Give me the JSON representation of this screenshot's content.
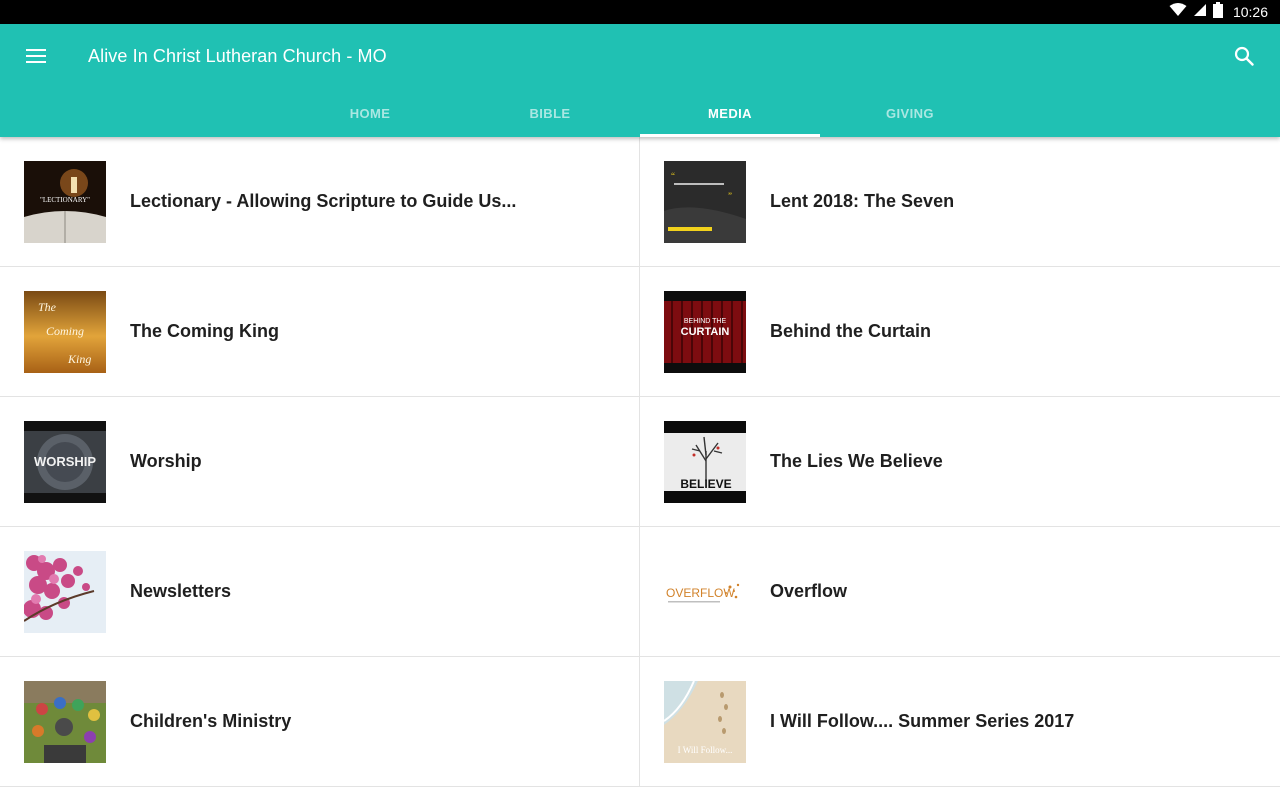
{
  "status": {
    "time": "10:26"
  },
  "appbar": {
    "title": "Alive In Christ Lutheran Church - MO",
    "tabs": [
      "HOME",
      "BIBLE",
      "MEDIA",
      "GIVING"
    ],
    "active_tab": "MEDIA"
  },
  "media_items": [
    {
      "label": "Lectionary - Allowing Scripture to Guide Us...",
      "thumb_text": "\"LECTIONARY\""
    },
    {
      "label": "Lent 2018: The Seven",
      "thumb_text": ""
    },
    {
      "label": "The Coming King",
      "thumb_text": "The Coming King"
    },
    {
      "label": "Behind the Curtain",
      "thumb_text": "BEHIND THE CURTAIN"
    },
    {
      "label": "Worship",
      "thumb_text": "WORSHIP"
    },
    {
      "label": "The Lies We Believe",
      "thumb_text": "BELIEVE"
    },
    {
      "label": "Newsletters",
      "thumb_text": ""
    },
    {
      "label": "Overflow",
      "thumb_text": "OVERFLOW"
    },
    {
      "label": "Children's Ministry",
      "thumb_text": ""
    },
    {
      "label": "I Will Follow.... Summer Series 2017",
      "thumb_text": "I Will Follow..."
    }
  ],
  "colors": {
    "primary": "#20c1b3",
    "status_bar": "#000000",
    "divider": "#e3e3e3"
  }
}
